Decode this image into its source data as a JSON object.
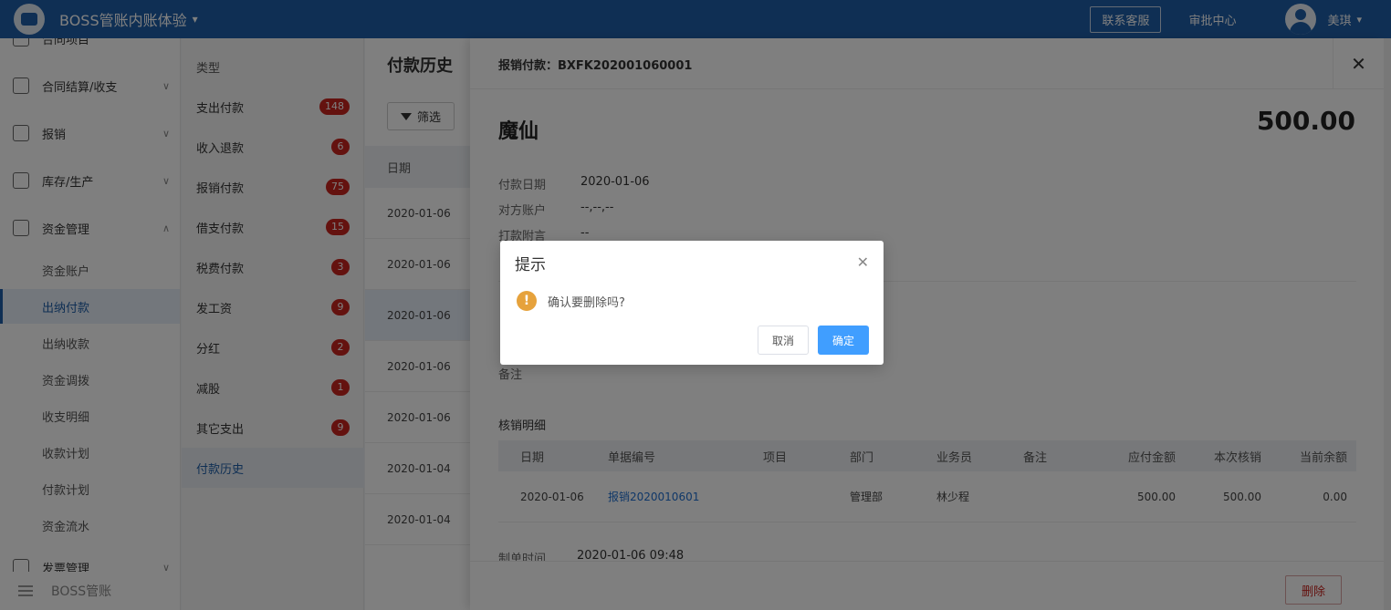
{
  "header": {
    "app_title": "BOSS管账内账体验",
    "customer_service": "联系客服",
    "approval_center": "审批中心",
    "user_name": "美琪"
  },
  "sidebar": {
    "groups": [
      {
        "label": "合同项目",
        "icon": "contract-icon"
      },
      {
        "label": "合同结算/收支",
        "icon": "settlement-icon"
      },
      {
        "label": "报销",
        "icon": "reimburse-icon"
      },
      {
        "label": "库存/生产",
        "icon": "inventory-icon"
      },
      {
        "label": "资金管理",
        "icon": "funds-icon"
      },
      {
        "label": "发票管理",
        "icon": "invoice-icon"
      }
    ],
    "sub_items": [
      "资金账户",
      "出纳付款",
      "出纳收款",
      "资金调拨",
      "收支明细",
      "收款计划",
      "付款计划",
      "资金流水"
    ],
    "active_sub": "出纳付款",
    "footer_brand": "BOSS管账"
  },
  "types": {
    "header": "类型",
    "items": [
      {
        "label": "支出付款",
        "count": "148"
      },
      {
        "label": "收入退款",
        "count": "6"
      },
      {
        "label": "报销付款",
        "count": "75"
      },
      {
        "label": "借支付款",
        "count": "15"
      },
      {
        "label": "税费付款",
        "count": "3"
      },
      {
        "label": "发工资",
        "count": "9"
      },
      {
        "label": "分红",
        "count": "2"
      },
      {
        "label": "减股",
        "count": "1"
      },
      {
        "label": "其它支出",
        "count": "9"
      },
      {
        "label": "付款历史",
        "count": ""
      }
    ],
    "active": "付款历史"
  },
  "history": {
    "title": "付款历史",
    "filter_label": "筛选",
    "col_date": "日期",
    "rows": [
      "2020-01-06",
      "2020-01-06",
      "2020-01-06",
      "2020-01-06",
      "2020-01-06",
      "2020-01-04",
      "2020-01-04"
    ]
  },
  "detail": {
    "title": "报销付款：BXFK202001060001",
    "payee": "魔仙",
    "amount": "500.00",
    "fields": [
      {
        "label": "付款日期",
        "value": "2020-01-06"
      },
      {
        "label": "对方账户",
        "value": "--,--,--"
      },
      {
        "label": "打款附言",
        "value": "--"
      }
    ],
    "remark_label": "备注",
    "section_title": "核销明细",
    "table_headers": [
      "日期",
      "单据编号",
      "项目",
      "部门",
      "业务员",
      "备注",
      "应付金额",
      "本次核销",
      "当前余额"
    ],
    "table_row": [
      "2020-01-06",
      "报销2020010601",
      "",
      "管理部",
      "林少程",
      "",
      "500.00",
      "500.00",
      "0.00"
    ],
    "created_label": "制单时间",
    "created_value": "2020-01-06 09:48",
    "delete_label": "删除"
  },
  "modal": {
    "title": "提示",
    "message": "确认要删除吗?",
    "cancel": "取消",
    "confirm": "确定"
  },
  "colors": {
    "header_bg": "#1f5fa8",
    "badge": "#c8241f",
    "primary_button": "#409eff",
    "warning_icon": "#e6a23c"
  }
}
